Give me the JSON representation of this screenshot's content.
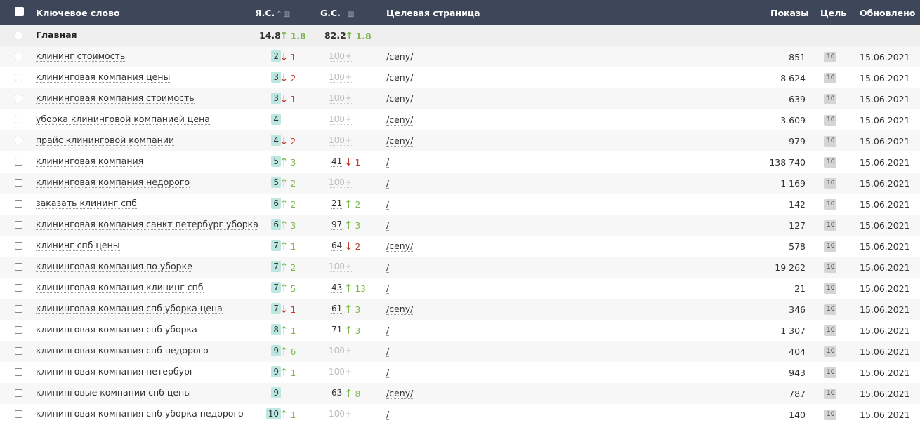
{
  "header": {
    "keyword": "Ключевое слово",
    "yandex": "Я.С.",
    "google": "G.C.",
    "url": "Целевая страница",
    "shows": "Показы",
    "goal": "Цель",
    "updated": "Обновлено",
    "sort_icon": "sort-icon",
    "chart_icon": "bar-chart-icon"
  },
  "group": {
    "label": "Главная",
    "ya_avg": "14.8",
    "ya_dyn": "1.8",
    "g_avg": "82.2",
    "g_dyn": "1.8"
  },
  "rows": [
    {
      "kw": "клининг стоимость",
      "ya": "2",
      "ya_dir": "dn",
      "ya_d": "1",
      "g": "100+",
      "g_dir": "",
      "g_d": "",
      "url": "/ceny/",
      "shows": "851",
      "goal": "10",
      "date": "15.06.2021"
    },
    {
      "kw": "клининговая компания цены",
      "ya": "3",
      "ya_dir": "dn",
      "ya_d": "2",
      "g": "100+",
      "g_dir": "",
      "g_d": "",
      "url": "/ceny/",
      "shows": "8 624",
      "goal": "10",
      "date": "15.06.2021"
    },
    {
      "kw": "клининговая компания стоимость",
      "ya": "3",
      "ya_dir": "dn",
      "ya_d": "1",
      "g": "100+",
      "g_dir": "",
      "g_d": "",
      "url": "/ceny/",
      "shows": "639",
      "goal": "10",
      "date": "15.06.2021"
    },
    {
      "kw": "уборка клининговой компанией цена",
      "ya": "4",
      "ya_dir": "",
      "ya_d": "",
      "g": "100+",
      "g_dir": "",
      "g_d": "",
      "url": "/ceny/",
      "shows": "3 609",
      "goal": "10",
      "date": "15.06.2021"
    },
    {
      "kw": "прайс клининговой компании",
      "ya": "4",
      "ya_dir": "dn",
      "ya_d": "2",
      "g": "100+",
      "g_dir": "",
      "g_d": "",
      "url": "/ceny/",
      "shows": "979",
      "goal": "10",
      "date": "15.06.2021"
    },
    {
      "kw": "клининговая компания",
      "ya": "5",
      "ya_dir": "up",
      "ya_d": "3",
      "g": "41",
      "g_dir": "dn",
      "g_d": "1",
      "url": "/",
      "shows": "138 740",
      "goal": "10",
      "date": "15.06.2021"
    },
    {
      "kw": "клининговая компания недорого",
      "ya": "5",
      "ya_dir": "up",
      "ya_d": "2",
      "g": "100+",
      "g_dir": "",
      "g_d": "",
      "url": "/",
      "shows": "1 169",
      "goal": "10",
      "date": "15.06.2021"
    },
    {
      "kw": "заказать клининг спб",
      "ya": "6",
      "ya_dir": "up",
      "ya_d": "2",
      "g": "21",
      "g_dir": "up",
      "g_d": "2",
      "url": "/",
      "shows": "142",
      "goal": "10",
      "date": "15.06.2021"
    },
    {
      "kw": "клининговая компания санкт петербург уборка",
      "ya": "6",
      "ya_dir": "up",
      "ya_d": "3",
      "g": "97",
      "g_dir": "up",
      "g_d": "3",
      "url": "/",
      "shows": "127",
      "goal": "10",
      "date": "15.06.2021"
    },
    {
      "kw": "клининг спб цены",
      "ya": "7",
      "ya_dir": "up",
      "ya_d": "1",
      "g": "64",
      "g_dir": "dn",
      "g_d": "2",
      "url": "/ceny/",
      "shows": "578",
      "goal": "10",
      "date": "15.06.2021"
    },
    {
      "kw": "клининговая компания по уборке",
      "ya": "7",
      "ya_dir": "up",
      "ya_d": "2",
      "g": "100+",
      "g_dir": "",
      "g_d": "",
      "url": "/",
      "shows": "19 262",
      "goal": "10",
      "date": "15.06.2021"
    },
    {
      "kw": "клининговая компания клининг спб",
      "ya": "7",
      "ya_dir": "up",
      "ya_d": "5",
      "g": "43",
      "g_dir": "up",
      "g_d": "13",
      "url": "/",
      "shows": "21",
      "goal": "10",
      "date": "15.06.2021"
    },
    {
      "kw": "клининговая компания спб уборка цена",
      "ya": "7",
      "ya_dir": "dn",
      "ya_d": "1",
      "g": "61",
      "g_dir": "up",
      "g_d": "3",
      "url": "/ceny/",
      "shows": "346",
      "goal": "10",
      "date": "15.06.2021"
    },
    {
      "kw": "клининговая компания спб уборка",
      "ya": "8",
      "ya_dir": "up",
      "ya_d": "1",
      "g": "71",
      "g_dir": "up",
      "g_d": "3",
      "url": "/",
      "shows": "1 307",
      "goal": "10",
      "date": "15.06.2021"
    },
    {
      "kw": "клининговая компания спб недорого",
      "ya": "9",
      "ya_dir": "up",
      "ya_d": "6",
      "g": "100+",
      "g_dir": "",
      "g_d": "",
      "url": "/",
      "shows": "404",
      "goal": "10",
      "date": "15.06.2021"
    },
    {
      "kw": "клининговая компания петербург",
      "ya": "9",
      "ya_dir": "up",
      "ya_d": "1",
      "g": "100+",
      "g_dir": "",
      "g_d": "",
      "url": "/",
      "shows": "943",
      "goal": "10",
      "date": "15.06.2021"
    },
    {
      "kw": "клининговые компании спб цены",
      "ya": "9",
      "ya_dir": "",
      "ya_d": "",
      "g": "63",
      "g_dir": "up",
      "g_d": "8",
      "url": "/ceny/",
      "shows": "787",
      "goal": "10",
      "date": "15.06.2021"
    },
    {
      "kw": "клининговая компания спб уборка недорого",
      "ya": "10",
      "ya_dir": "up",
      "ya_d": "1",
      "g": "100+",
      "g_dir": "",
      "g_d": "",
      "url": "/",
      "shows": "140",
      "goal": "10",
      "date": "15.06.2021"
    }
  ],
  "colors": {
    "header_bg": "#3e4759",
    "up": "#7ab648",
    "down": "#c0392b",
    "badge": "#bfe7e2"
  }
}
